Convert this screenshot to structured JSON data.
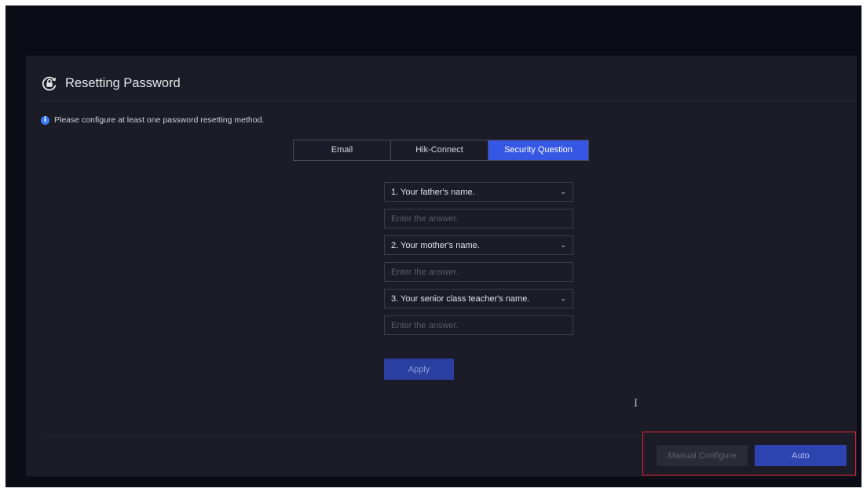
{
  "dialog": {
    "title": "Resetting Password",
    "notice": "Please configure at least one password resetting method."
  },
  "tabs": [
    {
      "label": "Email",
      "active": false
    },
    {
      "label": "Hik-Connect",
      "active": false
    },
    {
      "label": "Security Question",
      "active": true
    }
  ],
  "questions": [
    {
      "question": "1. Your father's name.",
      "answer_placeholder": "Enter the answer."
    },
    {
      "question": "2. Your mother's name.",
      "answer_placeholder": "Enter the answer."
    },
    {
      "question": "3. Your senior class teacher's name.",
      "answer_placeholder": "Enter the answer."
    }
  ],
  "apply_label": "Apply",
  "footer": {
    "manual_label": "Manual Configure",
    "auto_label": "Auto"
  },
  "colors": {
    "accent": "#3557e4",
    "highlight": "#e0222a"
  }
}
